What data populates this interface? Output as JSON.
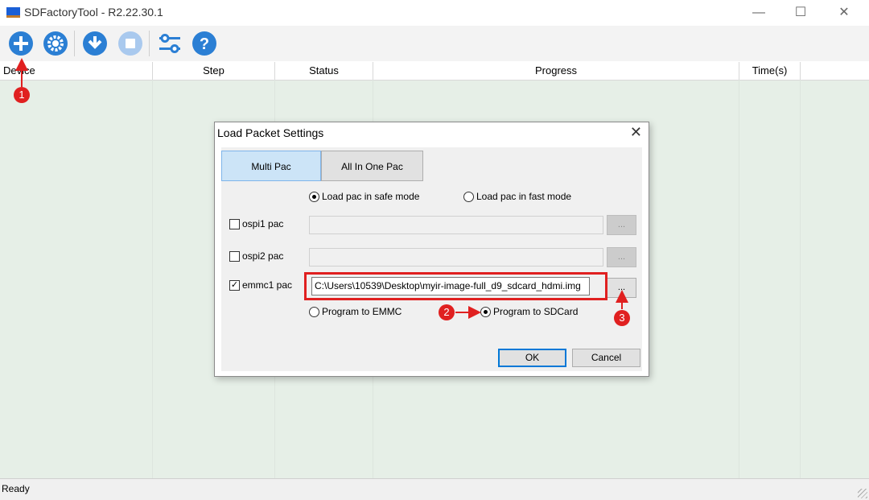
{
  "window": {
    "title": "SDFactoryTool - R2.22.30.1"
  },
  "toolbar": {
    "buttons": [
      {
        "name": "add-icon",
        "color": "#2b7fd4"
      },
      {
        "name": "settings-icon",
        "color": "#2b7fd4"
      },
      {
        "name": "download-icon",
        "color": "#2b7fd4"
      },
      {
        "name": "stop-icon",
        "color": "#a9c9ee"
      },
      {
        "name": "config-icon",
        "color": "#2b7fd4"
      },
      {
        "name": "help-icon",
        "color": "#2b7fd4"
      }
    ]
  },
  "grid": {
    "columns": [
      "Device",
      "Step",
      "Status",
      "Progress",
      "Time(s)"
    ]
  },
  "status": {
    "text": "Ready"
  },
  "dialog": {
    "title": "Load Packet Settings",
    "tabs": [
      "Multi Pac",
      "All In One Pac"
    ],
    "mode_options": [
      "Load pac in safe mode",
      "Load pac in fast mode"
    ],
    "mode_selected": "Load pac in safe mode",
    "rows": [
      {
        "label": "ospi1 pac",
        "checked": false,
        "value": ""
      },
      {
        "label": "ospi2 pac",
        "checked": false,
        "value": ""
      },
      {
        "label": "emmc1 pac",
        "checked": true,
        "value": "C:\\Users\\10539\\Desktop\\myir-image-full_d9_sdcard_hdmi.img"
      }
    ],
    "browse_label": "...",
    "target_options": [
      "Program to EMMC",
      "Program to SDCard"
    ],
    "target_selected": "Program to SDCard",
    "ok_label": "OK",
    "cancel_label": "Cancel"
  },
  "annotations": {
    "badges": [
      "1",
      "2",
      "3"
    ],
    "color": "#e02020"
  }
}
